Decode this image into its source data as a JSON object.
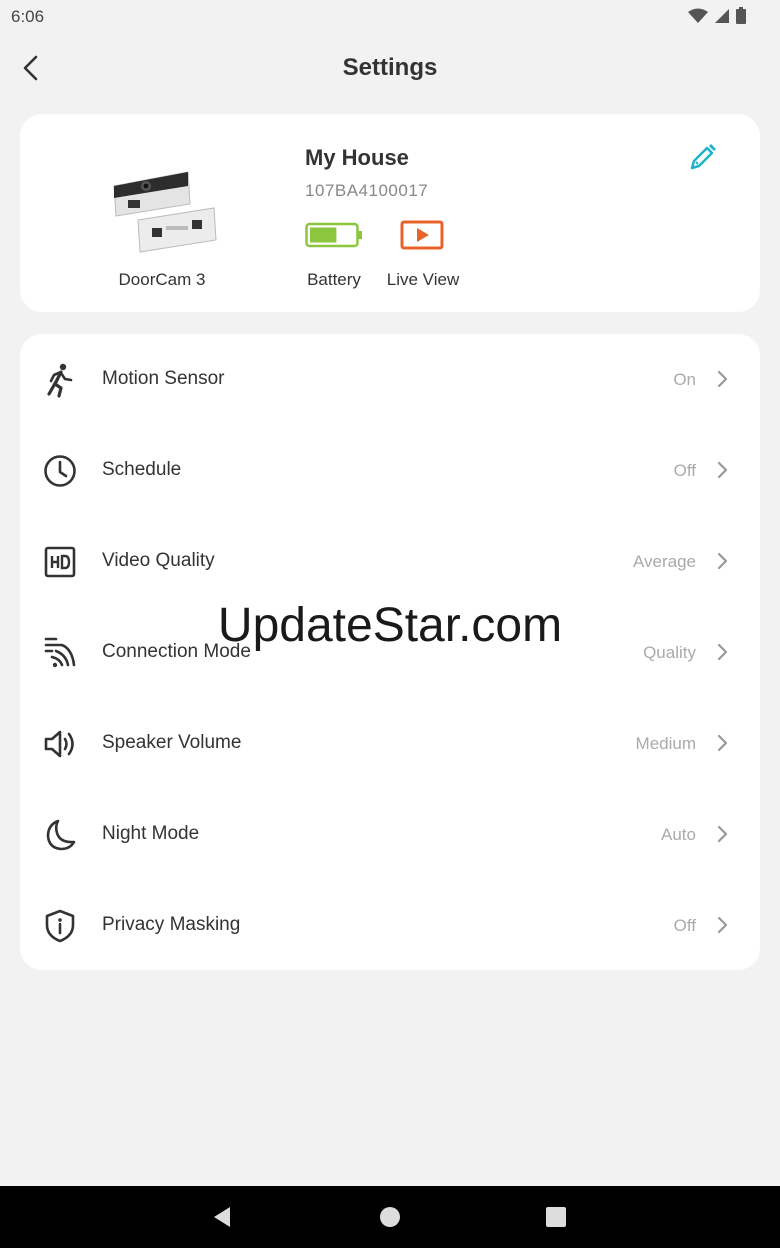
{
  "status_bar": {
    "time": "6:06"
  },
  "header": {
    "title": "Settings"
  },
  "device": {
    "name": "My House",
    "serial": "107BA4100017",
    "model": "DoorCam 3",
    "battery_label": "Battery",
    "battery_level": 0.6,
    "live_view_label": "Live View"
  },
  "settings": [
    {
      "label": "Motion Sensor",
      "value": "On",
      "icon": "running-person-icon"
    },
    {
      "label": "Schedule",
      "value": "Off",
      "icon": "clock-icon"
    },
    {
      "label": "Video Quality",
      "value": "Average",
      "icon": "hd-icon"
    },
    {
      "label": "Connection Mode",
      "value": "Quality",
      "icon": "signal-waves-icon"
    },
    {
      "label": "Speaker Volume",
      "value": "Medium",
      "icon": "speaker-icon"
    },
    {
      "label": "Night Mode",
      "value": "Auto",
      "icon": "moon-icon"
    },
    {
      "label": "Privacy Masking",
      "value": "Off",
      "icon": "shield-info-icon"
    }
  ],
  "watermark": "UpdateStar.com",
  "colors": {
    "accent": "#1fb3c9",
    "battery": "#8cc63f",
    "live_view": "#e8632a"
  }
}
